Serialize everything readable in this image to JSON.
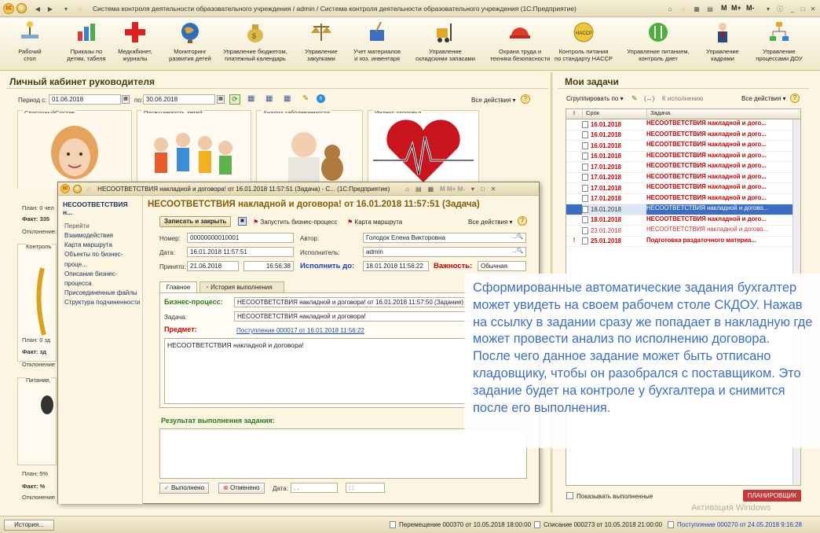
{
  "window": {
    "title": "Система контроля деятельности образовательного учреждения / admin / Система контроля деятельности образовательного учреждения  (1С:Предприятие)",
    "mem": [
      "M",
      "M+",
      "M-"
    ]
  },
  "toolbar": [
    {
      "label": "Рабочий\nстол",
      "icon": "desk-icon"
    },
    {
      "label": "Приказы по\nдетям, табеля",
      "icon": "chart-icon"
    },
    {
      "label": "Медкабинет,\nжурналы",
      "icon": "cross-icon"
    },
    {
      "label": "Мониторинг\nразвития детей",
      "icon": "globe-icon"
    },
    {
      "label": "Управление бюджетом,\nплатежный календарь",
      "icon": "money-bag-icon"
    },
    {
      "label": "Управление\nзакупками",
      "icon": "scales-icon"
    },
    {
      "label": "Учет материалов\nи хоз. инвентаря",
      "icon": "cleaning-icon"
    },
    {
      "label": "Управление\nскладскими запасами",
      "icon": "forklift-icon"
    },
    {
      "label": "Охрана труда и\nтехника безопасности",
      "icon": "helmet-icon"
    },
    {
      "label": "Контроль питания\nпо стандарту HACCP",
      "icon": "haccp-badge-icon"
    },
    {
      "label": "Управление питанием,\nконтроль диет",
      "icon": "fork-knife-icon"
    },
    {
      "label": "Управление\nкадрами",
      "icon": "person-icon"
    },
    {
      "label": "Управление\nпроцессами ДОУ",
      "icon": "process-icon"
    }
  ],
  "left": {
    "title": "Личный кабинет руководителя",
    "period_label": "Период с:",
    "date_from": "01.06.2018",
    "to_label": "по:",
    "date_to": "30.06.2018",
    "all_actions": "Все действия",
    "tiles": [
      "СписочныйСостав",
      "Посещаемость детей",
      "Анализ заболеваемости",
      "Индекс здоровья"
    ],
    "side": [
      "План: 0 чел",
      "Факт: 335",
      "Отклонение:",
      "Контроль",
      "План: 0 зд",
      "Факт: зд",
      "Отклонение",
      "Питание,",
      "План: 5%",
      "Факт: %",
      "Отклонение"
    ]
  },
  "right": {
    "title": "Мои задачи",
    "group_by": "Сгруппировать по",
    "to_execute": "К исполнению",
    "all_actions": "Все действия",
    "col_deadline": "Срок",
    "col_task": "Задача",
    "rows": [
      {
        "date": "16.01.2018",
        "task": "НЕСООТВЕТСТВИЯ накладной и дого...",
        "style": "red",
        "flag": ""
      },
      {
        "date": "16.01.2018",
        "task": "НЕСООТВЕТСТВИЯ накладной и дого...",
        "style": "red",
        "flag": ""
      },
      {
        "date": "16.01.2018",
        "task": "НЕСООТВЕТСТВИЯ накладной и дого...",
        "style": "red",
        "flag": ""
      },
      {
        "date": "16.01.2018",
        "task": "НЕСООТВЕТСТВИЯ накладной и дого...",
        "style": "red",
        "flag": ""
      },
      {
        "date": "17.01.2018",
        "task": "НЕСООТВЕТСТВИЯ накладной и дого...",
        "style": "red",
        "flag": ""
      },
      {
        "date": "17.01.2018",
        "task": "НЕСООТВЕТСТВИЯ накладной и дого...",
        "style": "red",
        "flag": ""
      },
      {
        "date": "17.01.2018",
        "task": "НЕСООТВЕТСТВИЯ накладной и дого...",
        "style": "red",
        "flag": ""
      },
      {
        "date": "17.01.2018",
        "task": "НЕСООТВЕТСТВИЯ накладной и дого...",
        "style": "red",
        "flag": ""
      },
      {
        "date": "18.01.2018",
        "task": "НЕСООТВЕТСТВИЯ накладной и догово...",
        "style": "sel",
        "flag": ""
      },
      {
        "date": "18.01.2018",
        "task": "НЕСООТВЕТСТВИЯ накладной и дого...",
        "style": "red",
        "flag": ""
      },
      {
        "date": "23.01.2018",
        "task": "НЕСООТВЕТСТВИЯ накладной и догово...",
        "style": "pink",
        "flag": ""
      },
      {
        "date": "25.01.2018",
        "task": "Подготовка раздаточного материа...",
        "style": "red",
        "flag": "!"
      }
    ],
    "show_done": "Показывать выполненные",
    "planner": "ПЛАНИРОВЩИК"
  },
  "dialog": {
    "title": "НЕСООТВЕТСТВИЯ накладной и договора! от 16.01.2018 11:57:51 (Задача) - С...  (1С:Предприятие)",
    "nav_name": "НЕСООТВЕТСТВИЯ н...",
    "nav_go": "Перейти",
    "nav": [
      "Взаимодействия",
      "Карта маршрута",
      "Объекты по бизнес-проце...",
      "Описание бизнес-процесса",
      "Присоединенные файлы",
      "Структура подчиненности"
    ],
    "heading": "НЕСООТВЕТСТВИЯ накладной и договора! от 16.01.2018 11:57:51 (Задача)",
    "save_close": "Записать и закрыть",
    "start_bp": "Запустить бизнес-процесс",
    "route_map": "Карта маршрута",
    "all_actions": "Все действия",
    "number_label": "Номер:",
    "number": "00000000010001",
    "author_label": "Автор:",
    "author": "Голодок Елена Викторовна",
    "date_label": "Дата:",
    "date": "16.01.2018 11:57:51",
    "executor_label": "Исполнитель:",
    "executor": "admin",
    "accepted_label": "Принято:",
    "accepted_date": "21.06.2018",
    "accepted_time": "16:56:38",
    "do_by_label": "Исполнить до:",
    "do_by": "18.01.2018 11:56:22",
    "importance_label": "Важность:",
    "importance": "Обычная",
    "tab_main": "Главное",
    "tab_history": "История выполнения",
    "bp_label": "Бизнес-процесс:",
    "bp": "НЕСООТВЕТСТВИЯ накладной и договора! от 16.01.2018 11:57:50 (Задание)",
    "task_label": "Задача:",
    "task": "НЕСООТВЕТСТВИЯ накладной и договора!",
    "subject_label": "Предмет:",
    "subject": "Поступление 000017 от 16.01.2018 11:56:22",
    "text": "НЕСООТВЕТСТВИЯ накладной и договора!",
    "result_label": "Результат выполнения задания:",
    "done": "Выполнено",
    "cancelled": "Отменено",
    "date2_label": "Дата:",
    "date2": ". .",
    "time2": ": :"
  },
  "overlay": "Сформированные автоматические задания бухгалтер может увидеть на своем рабочем столе СКДОУ. Нажав на ссылку в задании сразу же попадает в накладную где может провести анализ по исполнению договора.\nПосле чего данное задание может быть отписано кладовщику, чтобы он разобрался с поставщиком. Это задание будет на контроле у бухгалтера и снимится после его выполнения.",
  "status": {
    "history": "История...",
    "items": [
      "Перемещение 000370 от 10.05.2018 18:00:00",
      "Списание 000273 от 10.05.2018 21:00:00",
      "Поступление 000270 от 24.05.2018 9:16:28"
    ],
    "watermark": "Активация Windows"
  }
}
